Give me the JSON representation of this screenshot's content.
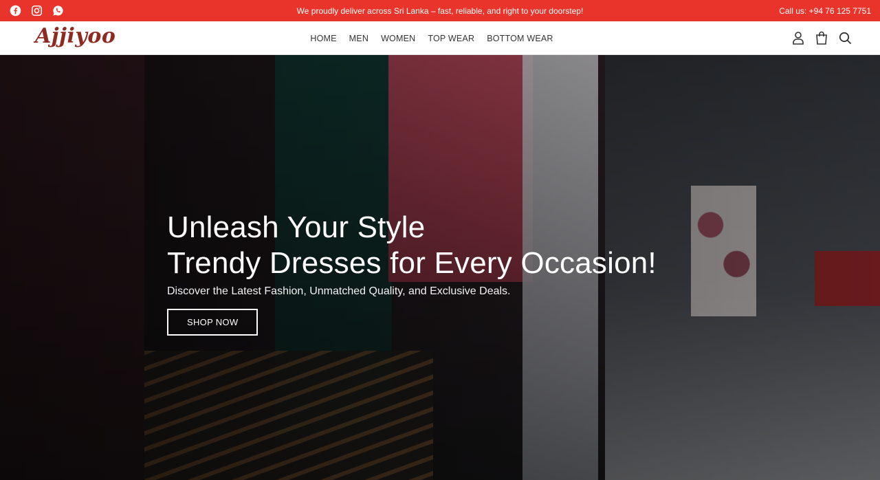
{
  "topbar": {
    "announcement": "We proudly deliver across Sri Lanka – fast, reliable, and right to your doorstep!",
    "call_us": "Call us: +94 76 125 7751",
    "social_icons": [
      "facebook-icon",
      "instagram-icon",
      "whatsapp-icon"
    ],
    "background_color": "#e8342a"
  },
  "header": {
    "logo": "Ajjiyoo",
    "nav": [
      "HOME",
      "MEN",
      "WOMEN",
      "TOP WEAR",
      "BOTTOM WEAR"
    ],
    "icons": [
      "user-icon",
      "shopping-bag-icon",
      "search-icon"
    ]
  },
  "hero": {
    "title_line1": "Unleash Your Style",
    "title_line2": "Trendy Dresses for Every Occasion!",
    "subtitle": "Discover the Latest Fashion, Unmatched Quality, and Exclusive Deals.",
    "cta": "SHOP NOW"
  },
  "colors": {
    "brand": "#8e2a22",
    "accent": "#e8342a"
  }
}
